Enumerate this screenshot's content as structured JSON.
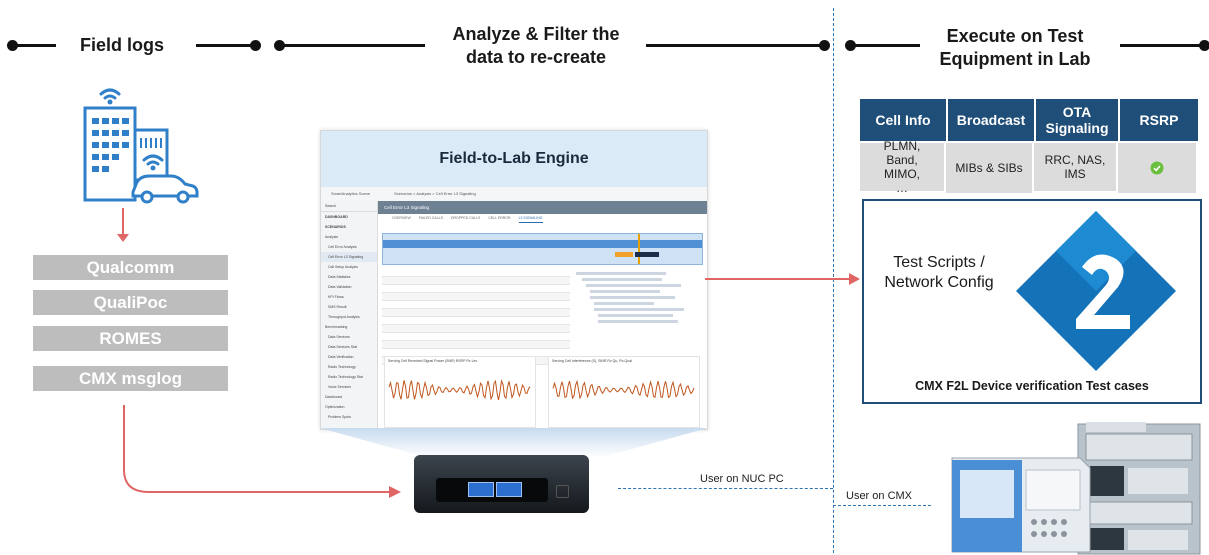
{
  "headers": {
    "field_logs": "Field logs",
    "analyze_line1": "Analyze & Filter the",
    "analyze_line2": "data to re-create",
    "execute_line1": "Execute on Test",
    "execute_line2": "Equipment in Lab"
  },
  "sources": [
    "Qualcomm",
    "QualiPoc",
    "ROMES",
    "CMX msglog"
  ],
  "engine": {
    "title": "Field-to-Lab Engine",
    "app_name": "SmartAnalytics Scene",
    "breadcrumb": "Scenarios > Analysis > Cell Error L3 Signaling",
    "tab_title": "Cell Error L3 Signaling",
    "search": "Search",
    "sidebar": [
      "DASHBOARD",
      "SCENARIOS",
      "Analysis",
      "Cell Error Analysis",
      "Cell Error L3 Signaling",
      "Call Setup Analysis",
      "Data Statistics",
      "Data Validation",
      "KPI Flows",
      "SMS Result",
      "Throughput Analysis",
      "Benchmarking",
      "Data Services",
      "Data Services Stat",
      "Data Verification",
      "Radio Technology",
      "Radio Technology Stat",
      "Voice Services",
      "Dashboard",
      "Optimization",
      "Problem Spots"
    ],
    "subtabs": [
      "OVERVIEW",
      "FAILED CALLS",
      "DROPPED CALLS",
      "CELL ERROR",
      "L3 SIGNALING"
    ],
    "chart1_title": "Serving Cell Received Signal Power (SNR) RSRP Rx Lev",
    "chart2_title": "Serving Cell Interference (S), SINR Rx Qu, Rx Qual"
  },
  "table": {
    "headers": [
      "Cell Info",
      "Broadcast",
      "OTA Signaling",
      "RSRP"
    ],
    "row": [
      "PLMN, Band, MIMO, …",
      "MIBs & SIBs",
      "RRC, NAS, IMS",
      "check-circle-icon"
    ]
  },
  "test_panel": {
    "label_line1": "Test Scripts /",
    "label_line2": "Network Config",
    "caption": "CMX F2L Device verification Test cases"
  },
  "connections": {
    "nuc": "User on NUC PC",
    "cmx": "User on CMX"
  },
  "colors": {
    "accent_navy": "#1f4e79",
    "source_gray": "#bdbdbd",
    "arrow_red": "#e06666",
    "logo_blue": "#1473b8"
  },
  "icons": [
    "building-icon",
    "wifi-icon",
    "car-icon",
    "nuc-pc-icon",
    "cmx-equipment-icon",
    "logo-icon"
  ]
}
